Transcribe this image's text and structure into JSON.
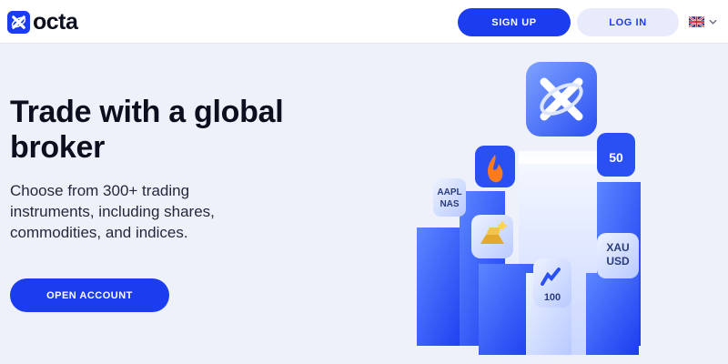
{
  "header": {
    "logo_text": "octa",
    "logo_icon": "octa-logo-icon",
    "signup_label": "SIGN UP",
    "login_label": "LOG IN",
    "language_icon": "uk-flag-icon"
  },
  "hero": {
    "title": "Trade with a global broker",
    "subtitle": "Choose from 300+ trading instruments, including shares, commodities, and indices.",
    "cta_label": "OPEN ACCOUNT"
  },
  "illustration": {
    "tiles": [
      {
        "icon": "octa-logo-tile"
      },
      {
        "icon": "fire-icon"
      },
      {
        "label_line1": "AAPL",
        "label_line2": "NAS"
      },
      {
        "icon": "gold-bars-icon"
      },
      {
        "label_line1": "50"
      },
      {
        "label_line1": "XAU",
        "label_line2": "USD"
      },
      {
        "label_line1": "100"
      }
    ]
  },
  "colors": {
    "brand": "#1c3cf0",
    "background": "#eef1fa",
    "login_bg": "#e7ebfb"
  }
}
